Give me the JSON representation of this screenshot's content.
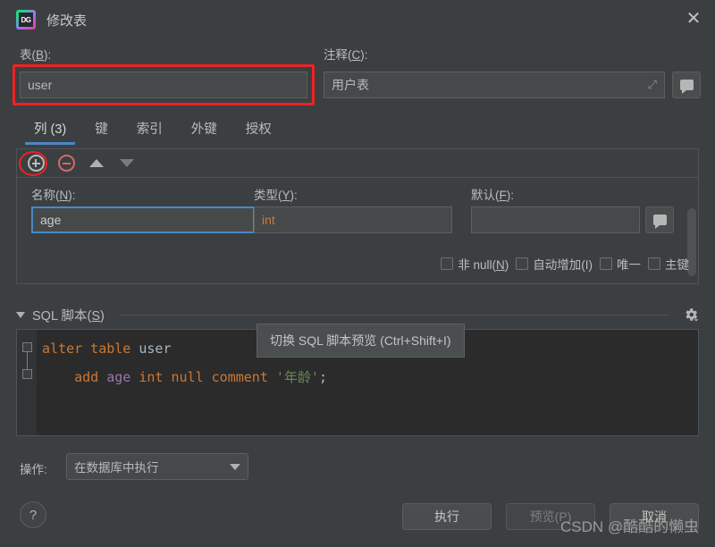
{
  "window": {
    "title": "修改表",
    "app_icon": "datagrip-icon",
    "close_label": "✕"
  },
  "top_fields": {
    "table_label": "表(B):",
    "table_value": "user",
    "comment_label": "注释(C):",
    "comment_value": "用户表",
    "expand_icon": "expand-icon",
    "comment_button_icon": "comment-bubble-icon"
  },
  "tabs": [
    {
      "label": "列 (3)",
      "active": true
    },
    {
      "label": "键",
      "active": false
    },
    {
      "label": "索引",
      "active": false
    },
    {
      "label": "外键",
      "active": false
    },
    {
      "label": "授权",
      "active": false
    }
  ],
  "toolbar": {
    "add_icon": "plus-circle-icon",
    "remove_icon": "minus-circle-icon",
    "move_up_icon": "arrow-up-icon",
    "move_down_icon": "arrow-down-icon"
  },
  "column_editor": {
    "name_label": "名称(N):",
    "name_value": "age",
    "type_label": "类型(Y):",
    "type_value": "int",
    "default_label": "默认(F):",
    "default_value": "",
    "default_button_icon": "comment-bubble-icon",
    "checkboxes": [
      {
        "label": "非 null(N)",
        "checked": false
      },
      {
        "label": "自动增加(I)",
        "checked": false
      },
      {
        "label": "唯一",
        "checked": false
      },
      {
        "label": "主键",
        "checked": false
      }
    ]
  },
  "sql_section": {
    "title": "SQL 脚本(S)",
    "collapse_icon": "triangle-down-icon",
    "settings_icon": "gear-icon",
    "code": {
      "line1": [
        {
          "t": "alter table ",
          "c": "kw"
        },
        {
          "t": "user",
          "c": "ident"
        }
      ],
      "line2": [
        {
          "t": "    add ",
          "c": "kw"
        },
        {
          "t": "age",
          "c": "col"
        },
        {
          "t": " int null comment ",
          "c": "kw"
        },
        {
          "t": "'年龄'",
          "c": "str"
        },
        {
          "t": ";",
          "c": "ident"
        }
      ]
    }
  },
  "tooltip": {
    "text": "切换 SQL 脚本预览 (Ctrl+Shift+I)"
  },
  "bottom": {
    "action_label": "操作:",
    "action_value": "在数据库中执行",
    "help_label": "?",
    "execute_label": "执行",
    "preview_label": "预览(P)",
    "cancel_label": "取消"
  },
  "watermark": {
    "text": "CSDN @酷酷的懒虫"
  },
  "colors": {
    "accent": "#4a88c7",
    "highlight": "#ee2222",
    "keyword": "#cc7832",
    "identifier": "#a9b7c6",
    "column": "#9876aa",
    "string": "#6a8759",
    "background": "#3c3f41",
    "editor_background": "#2b2b2b"
  }
}
